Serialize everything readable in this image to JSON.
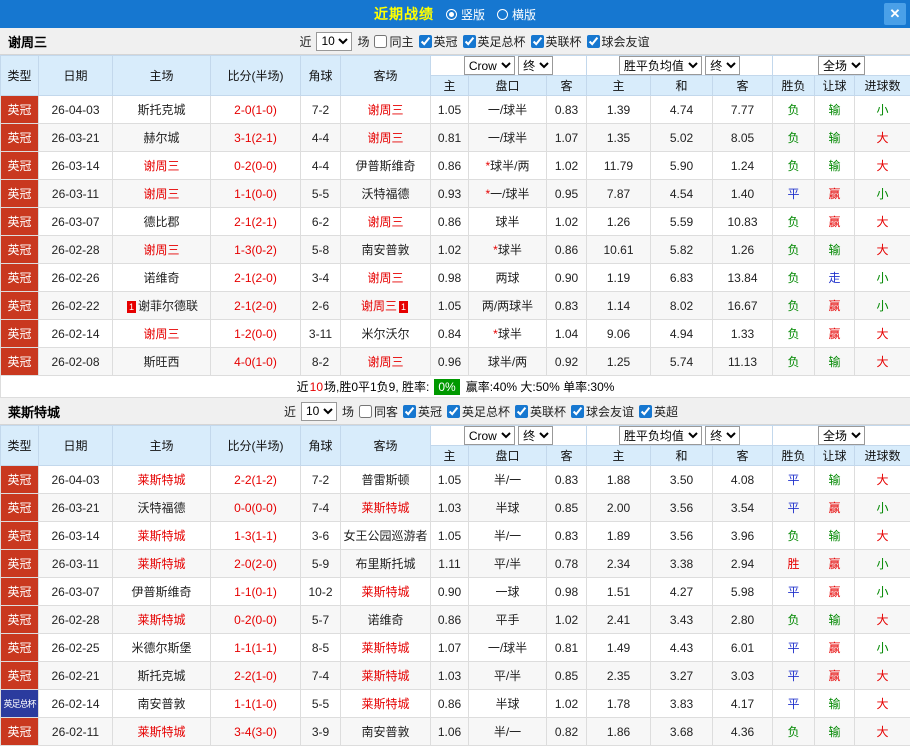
{
  "colors": {
    "topbar": "#1677d0",
    "title-yellow": "#ffff00",
    "header-blue": "#d8ecfb",
    "type-red": "#c9381f",
    "type-blue": "#2b3b9e",
    "red": "#e60000",
    "green": "#008800",
    "blue": "#2233cc",
    "badge-green": "#009900"
  },
  "titlebar": {
    "title": "近期战绩",
    "radio_vertical": "竖版",
    "radio_horizontal": "横版",
    "close": "✕"
  },
  "controls": {
    "near_label": "近",
    "count_value": "10",
    "games_label": "场",
    "odds_company": "Crow",
    "final_label": "终",
    "avg_label": "胜平负均值",
    "scope_label": "全场"
  },
  "table_header": {
    "type": "类型",
    "date": "日期",
    "home": "主场",
    "score": "比分(半场)",
    "corner": "角球",
    "away": "客场",
    "h": "主",
    "handicap": "盘口",
    "a": "客",
    "h2": "主",
    "d": "和",
    "a2": "客",
    "wl": "胜负",
    "let": "让球",
    "goals": "进球数"
  },
  "sections": [
    {
      "team": "谢周三",
      "same_label": "同主",
      "filters": [
        "英冠",
        "英足总杯",
        "英联杯",
        "球会友谊"
      ],
      "rows": [
        {
          "type": "英冠",
          "date": "26-04-03",
          "home": "斯托克城",
          "home_focus": false,
          "score": "2-0(1-0)",
          "corner": "7-2",
          "away": "谢周三",
          "away_focus": true,
          "o_h": "1.05",
          "handicap": "一/球半",
          "o_a": "0.83",
          "e_h": "1.39",
          "e_d": "4.74",
          "e_a": "7.77",
          "wl": "负",
          "rlet": "输",
          "goal": "小"
        },
        {
          "type": "英冠",
          "date": "26-03-21",
          "home": "赫尔城",
          "home_focus": false,
          "score": "3-1(2-1)",
          "corner": "4-4",
          "away": "谢周三",
          "away_focus": true,
          "o_h": "0.81",
          "handicap": "一/球半",
          "o_a": "1.07",
          "e_h": "1.35",
          "e_d": "5.02",
          "e_a": "8.05",
          "wl": "负",
          "rlet": "输",
          "goal": "大"
        },
        {
          "type": "英冠",
          "date": "26-03-14",
          "home": "谢周三",
          "home_focus": true,
          "score": "0-2(0-0)",
          "corner": "4-4",
          "away": "伊普斯维奇",
          "away_focus": false,
          "o_h": "0.86",
          "star": "*",
          "handicap": "球半/两",
          "o_a": "1.02",
          "e_h": "11.79",
          "e_d": "5.90",
          "e_a": "1.24",
          "wl": "负",
          "rlet": "输",
          "goal": "大"
        },
        {
          "type": "英冠",
          "date": "26-03-11",
          "home": "谢周三",
          "home_focus": true,
          "score": "1-1(0-0)",
          "corner": "5-5",
          "away": "沃特福德",
          "away_focus": false,
          "o_h": "0.93",
          "star": "*",
          "handicap": "一/球半",
          "o_a": "0.95",
          "e_h": "7.87",
          "e_d": "4.54",
          "e_a": "1.40",
          "wl": "平",
          "rlet": "赢",
          "goal": "小"
        },
        {
          "type": "英冠",
          "date": "26-03-07",
          "home": "德比郡",
          "home_focus": false,
          "score": "2-1(2-1)",
          "corner": "6-2",
          "away": "谢周三",
          "away_focus": true,
          "o_h": "0.86",
          "handicap": "球半",
          "o_a": "1.02",
          "e_h": "1.26",
          "e_d": "5.59",
          "e_a": "10.83",
          "wl": "负",
          "rlet": "赢",
          "goal": "大"
        },
        {
          "type": "英冠",
          "date": "26-02-28",
          "home": "谢周三",
          "home_focus": true,
          "score": "1-3(0-2)",
          "corner": "5-8",
          "away": "南安普敦",
          "away_focus": false,
          "o_h": "1.02",
          "star": "*",
          "handicap": "球半",
          "o_a": "0.86",
          "e_h": "10.61",
          "e_d": "5.82",
          "e_a": "1.26",
          "wl": "负",
          "rlet": "输",
          "goal": "大"
        },
        {
          "type": "英冠",
          "date": "26-02-26",
          "home": "诺维奇",
          "home_focus": false,
          "score": "2-1(2-0)",
          "corner": "3-4",
          "away": "谢周三",
          "away_focus": true,
          "o_h": "0.98",
          "handicap": "两球",
          "o_a": "0.90",
          "e_h": "1.19",
          "e_d": "6.83",
          "e_a": "13.84",
          "wl": "负",
          "rlet": "走",
          "goal": "小"
        },
        {
          "type": "英冠",
          "date": "26-02-22",
          "home": "谢菲尔德联",
          "home_focus": false,
          "home_badge": "1",
          "score": "2-1(2-0)",
          "corner": "2-6",
          "away": "谢周三",
          "away_focus": true,
          "away_badge": "1",
          "o_h": "1.05",
          "handicap": "两/两球半",
          "o_a": "0.83",
          "e_h": "1.14",
          "e_d": "8.02",
          "e_a": "16.67",
          "wl": "负",
          "rlet": "赢",
          "goal": "小"
        },
        {
          "type": "英冠",
          "date": "26-02-14",
          "home": "谢周三",
          "home_focus": true,
          "score": "1-2(0-0)",
          "corner": "3-11",
          "away": "米尔沃尔",
          "away_focus": false,
          "o_h": "0.84",
          "star": "*",
          "handicap": "球半",
          "o_a": "1.04",
          "e_h": "9.06",
          "e_d": "4.94",
          "e_a": "1.33",
          "wl": "负",
          "rlet": "赢",
          "goal": "大"
        },
        {
          "type": "英冠",
          "date": "26-02-08",
          "home": "斯旺西",
          "home_focus": false,
          "score": "4-0(1-0)",
          "corner": "8-2",
          "away": "谢周三",
          "away_focus": true,
          "o_h": "0.96",
          "handicap": "球半/两",
          "o_a": "0.92",
          "e_h": "1.25",
          "e_d": "5.74",
          "e_a": "11.13",
          "wl": "负",
          "rlet": "输",
          "goal": "大"
        }
      ],
      "summary": {
        "prefix": "近",
        "count": "10",
        "mid": "场,胜0平1负9, 胜率:",
        "win_rate": "0%",
        "rest": "赢率:40% 大:50% 单率:30%"
      }
    },
    {
      "team": "莱斯特城",
      "same_label": "同客",
      "filters": [
        "英冠",
        "英足总杯",
        "英联杯",
        "球会友谊",
        "英超"
      ],
      "rows": [
        {
          "type": "英冠",
          "date": "26-04-03",
          "home": "莱斯特城",
          "home_focus": true,
          "score": "2-2(1-2)",
          "corner": "7-2",
          "away": "普雷斯顿",
          "away_focus": false,
          "o_h": "1.05",
          "handicap": "半/一",
          "o_a": "0.83",
          "e_h": "1.88",
          "e_d": "3.50",
          "e_a": "4.08",
          "wl": "平",
          "rlet": "输",
          "goal": "大"
        },
        {
          "type": "英冠",
          "date": "26-03-21",
          "home": "沃特福德",
          "home_focus": false,
          "score": "0-0(0-0)",
          "corner": "7-4",
          "away": "莱斯特城",
          "away_focus": true,
          "o_h": "1.03",
          "handicap": "半球",
          "o_a": "0.85",
          "e_h": "2.00",
          "e_d": "3.56",
          "e_a": "3.54",
          "wl": "平",
          "rlet": "赢",
          "goal": "小"
        },
        {
          "type": "英冠",
          "date": "26-03-14",
          "home": "莱斯特城",
          "home_focus": true,
          "score": "1-3(1-1)",
          "corner": "3-6",
          "away": "女王公园巡游者",
          "away_focus": false,
          "o_h": "1.05",
          "handicap": "半/一",
          "o_a": "0.83",
          "e_h": "1.89",
          "e_d": "3.56",
          "e_a": "3.96",
          "wl": "负",
          "rlet": "输",
          "goal": "大"
        },
        {
          "type": "英冠",
          "date": "26-03-11",
          "home": "莱斯特城",
          "home_focus": true,
          "score": "2-0(2-0)",
          "corner": "5-9",
          "away": "布里斯托城",
          "away_focus": false,
          "o_h": "1.11",
          "handicap": "平/半",
          "o_a": "0.78",
          "e_h": "2.34",
          "e_d": "3.38",
          "e_a": "2.94",
          "wl": "胜",
          "rlet": "赢",
          "goal": "小"
        },
        {
          "type": "英冠",
          "date": "26-03-07",
          "home": "伊普斯维奇",
          "home_focus": false,
          "score": "1-1(0-1)",
          "corner": "10-2",
          "away": "莱斯特城",
          "away_focus": true,
          "o_h": "0.90",
          "handicap": "一球",
          "o_a": "0.98",
          "e_h": "1.51",
          "e_d": "4.27",
          "e_a": "5.98",
          "wl": "平",
          "rlet": "赢",
          "goal": "小"
        },
        {
          "type": "英冠",
          "date": "26-02-28",
          "home": "莱斯特城",
          "home_focus": true,
          "score": "0-2(0-0)",
          "corner": "5-7",
          "away": "诺维奇",
          "away_focus": false,
          "o_h": "0.86",
          "handicap": "平手",
          "o_a": "1.02",
          "e_h": "2.41",
          "e_d": "3.43",
          "e_a": "2.80",
          "wl": "负",
          "rlet": "输",
          "goal": "大"
        },
        {
          "type": "英冠",
          "date": "26-02-25",
          "home": "米德尔斯堡",
          "home_focus": false,
          "score": "1-1(1-1)",
          "corner": "8-5",
          "away": "莱斯特城",
          "away_focus": true,
          "o_h": "1.07",
          "handicap": "一/球半",
          "o_a": "0.81",
          "e_h": "1.49",
          "e_d": "4.43",
          "e_a": "6.01",
          "wl": "平",
          "rlet": "赢",
          "goal": "小"
        },
        {
          "type": "英冠",
          "date": "26-02-21",
          "home": "斯托克城",
          "home_focus": false,
          "score": "2-2(1-0)",
          "corner": "7-4",
          "away": "莱斯特城",
          "away_focus": true,
          "o_h": "1.03",
          "handicap": "平/半",
          "o_a": "0.85",
          "e_h": "2.35",
          "e_d": "3.27",
          "e_a": "3.03",
          "wl": "平",
          "rlet": "赢",
          "goal": "大"
        },
        {
          "type": "英足总杯",
          "type_color": "blue",
          "date": "26-02-14",
          "home": "南安普敦",
          "home_focus": false,
          "score": "1-1(1-0)",
          "corner": "5-5",
          "away": "莱斯特城",
          "away_focus": true,
          "o_h": "0.86",
          "handicap": "半球",
          "o_a": "1.02",
          "e_h": "1.78",
          "e_d": "3.83",
          "e_a": "4.17",
          "wl": "平",
          "rlet": "输",
          "goal": "大"
        },
        {
          "type": "英冠",
          "date": "26-02-11",
          "home": "莱斯特城",
          "home_focus": true,
          "score": "3-4(3-0)",
          "corner": "3-9",
          "away": "南安普敦",
          "away_focus": false,
          "o_h": "1.06",
          "handicap": "半/一",
          "o_a": "0.82",
          "e_h": "1.86",
          "e_d": "3.68",
          "e_a": "4.36",
          "wl": "负",
          "rlet": "输",
          "goal": "大"
        }
      ]
    }
  ]
}
